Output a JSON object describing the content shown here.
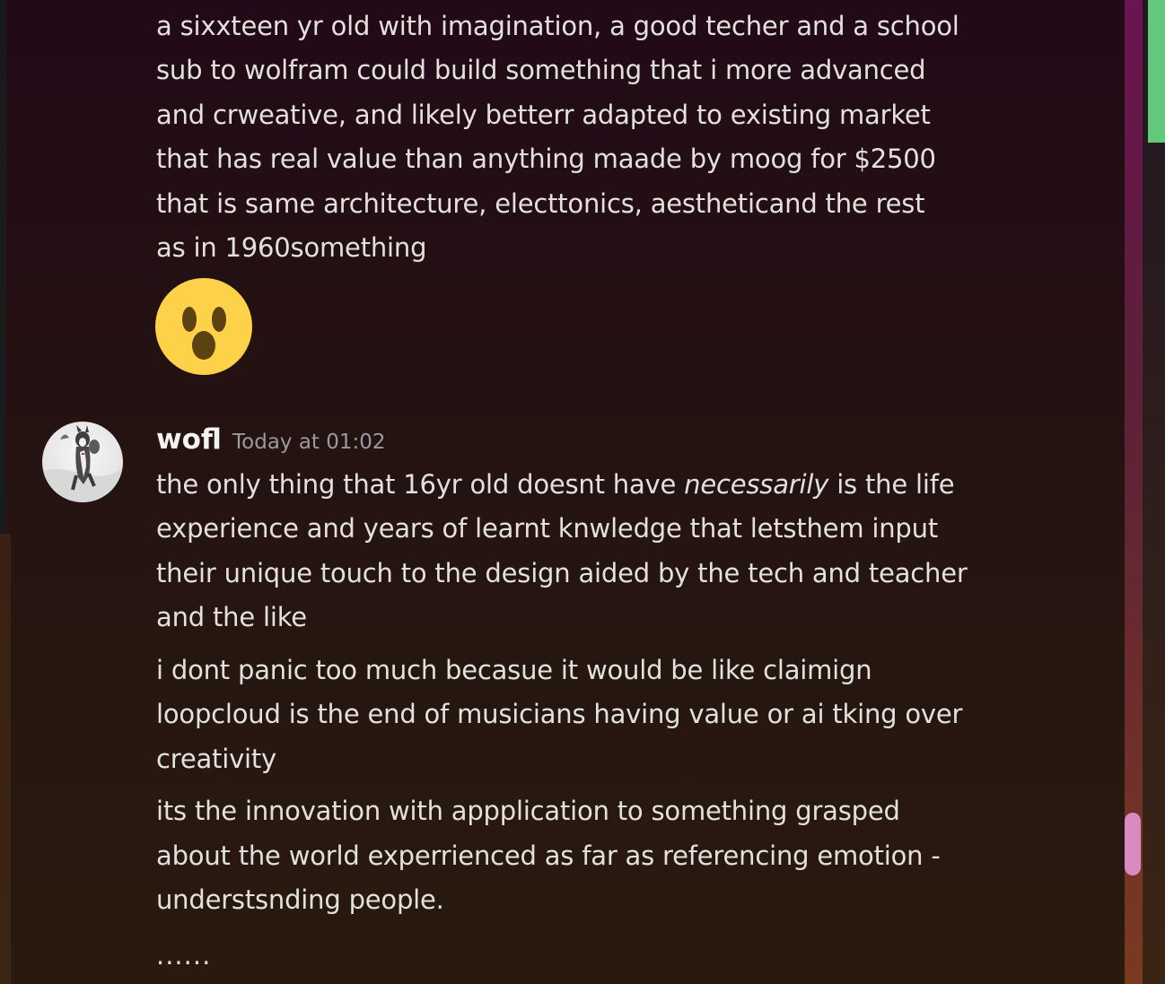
{
  "messages": [
    {
      "continuation_lines": [
        "a sixxteen yr old with imagination, a good techer and a school",
        "sub to wolfram could build something that i more advanced",
        "and crweative, and likely betterr adapted to existing market",
        "that has real value than anything maade by moog for $2500",
        "that is same architecture, electtonics, aestheticand the rest",
        "as in 1960something"
      ],
      "emoji": "astonished-face"
    },
    {
      "author": "wofl",
      "timestamp": "Today at 01:02",
      "paragraphs": [
        {
          "line1_before": "the only thing that 16yr old doesnt have ",
          "line1_italic": "necessarily",
          "line1_after": " is the life",
          "lines": [
            "experience and years of learnt knwledge that letsthem input",
            "their unique touch to the design aided by the tech and teacher",
            "and the like"
          ]
        },
        {
          "lines": [
            "i dont panic too much becasue it would be like claimign",
            "loopcloud is the end of musicians having value or ai tking over",
            "creativity"
          ]
        },
        {
          "lines": [
            "its the innovation with appplication to something grasped",
            "about the world experrienced as far as referencing emotion -",
            "understsnding people."
          ]
        }
      ],
      "trailing": "......"
    }
  ],
  "colors": {
    "text": "#e3e1dc",
    "username": "#f2f2f2",
    "timestamp": "#9a9aa0",
    "scroll_thumb": "#d98bc0",
    "accent": "#62c97a"
  }
}
